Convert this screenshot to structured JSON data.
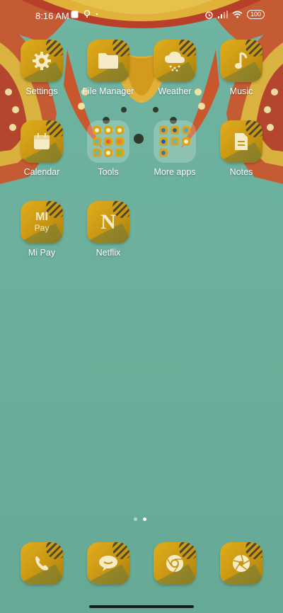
{
  "status_bar": {
    "time": "8:16 AM",
    "battery": "100"
  },
  "home": {
    "row1": [
      {
        "label": "Settings",
        "icon": "gear-icon"
      },
      {
        "label": "File Manager",
        "icon": "folder-icon"
      },
      {
        "label": "Weather",
        "icon": "cloud-rain-icon"
      },
      {
        "label": "Music",
        "icon": "music-note-icon"
      }
    ],
    "row2": [
      {
        "label": "Calendar",
        "icon": "calendar-icon"
      },
      {
        "label": "Tools",
        "icon": "folder-grid-icon"
      },
      {
        "label": "More apps",
        "icon": "folder-grid-icon"
      },
      {
        "label": "Notes",
        "icon": "note-icon"
      }
    ],
    "row3": [
      {
        "label": "Mi Pay",
        "icon": "mi-pay-icon",
        "text": "Pay",
        "logo": "MI"
      },
      {
        "label": "Netflix",
        "icon": "netflix-icon",
        "logo": "N"
      }
    ]
  },
  "pager": {
    "pages": 2,
    "active_page": 2
  },
  "dock": [
    {
      "icon": "phone-icon"
    },
    {
      "icon": "messages-icon"
    },
    {
      "icon": "browser-icon"
    },
    {
      "icon": "camera-icon"
    }
  ],
  "colors": {
    "background": "#6aaf9c",
    "tile": "#d7a515",
    "mandala_red": "#c64a2a",
    "mandala_gold": "#e0b23a"
  }
}
